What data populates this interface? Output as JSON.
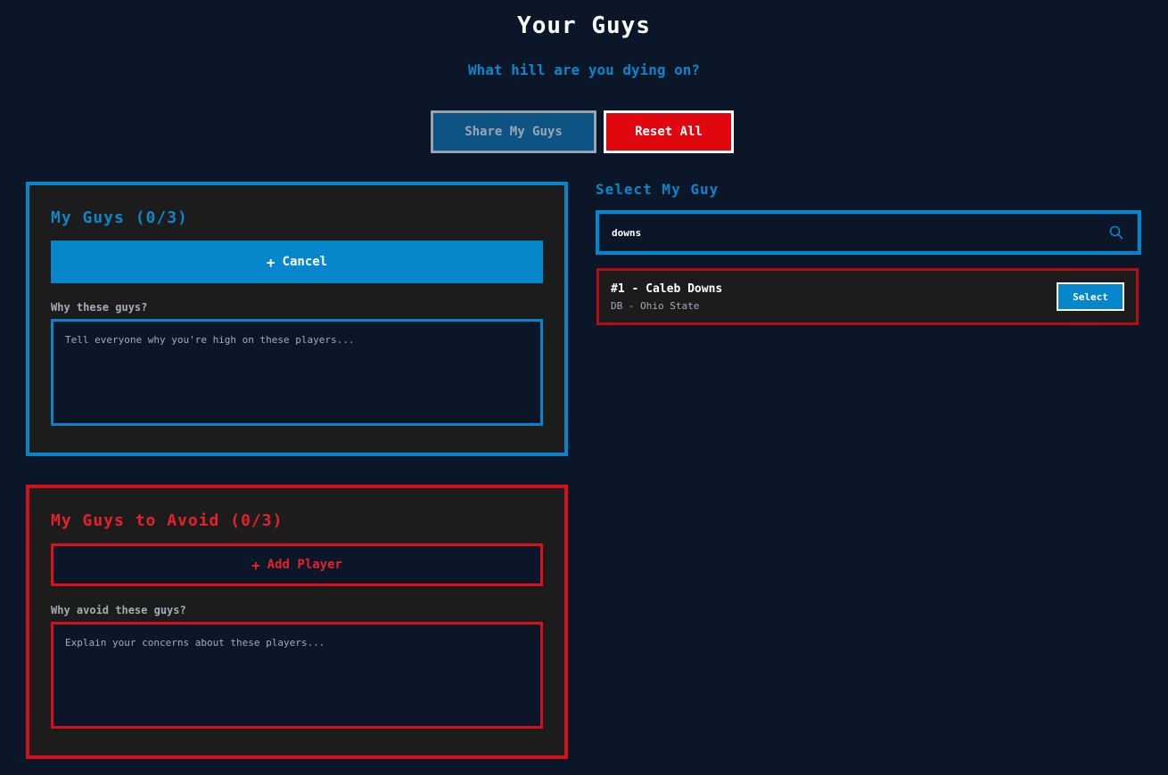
{
  "header": {
    "title": "Your Guys",
    "subtitle": "What hill are you dying on?"
  },
  "actions": {
    "share_label": "Share My Guys",
    "reset_label": "Reset All"
  },
  "my_guys": {
    "heading": "My Guys (0/3)",
    "action_label": "Cancel",
    "reason_label": "Why these guys?",
    "reason_placeholder": "Tell everyone why you're high on these players..."
  },
  "avoid": {
    "heading": "My Guys to Avoid (0/3)",
    "action_label": "Add Player",
    "reason_label": "Why avoid these guys?",
    "reason_placeholder": "Explain your concerns about these players..."
  },
  "select": {
    "heading": "Select My Guy",
    "search_value": "downs",
    "results": [
      {
        "name": "#1 - Caleb Downs",
        "meta": "DB - Ohio State",
        "button_label": "Select"
      }
    ]
  },
  "icons": {
    "plus": "plus-icon",
    "search": "search-icon"
  },
  "colors": {
    "background": "#0b1628",
    "accent_blue": "#0a86c9",
    "accent_red": "#e0070f",
    "panel": "#1c1c1c"
  }
}
